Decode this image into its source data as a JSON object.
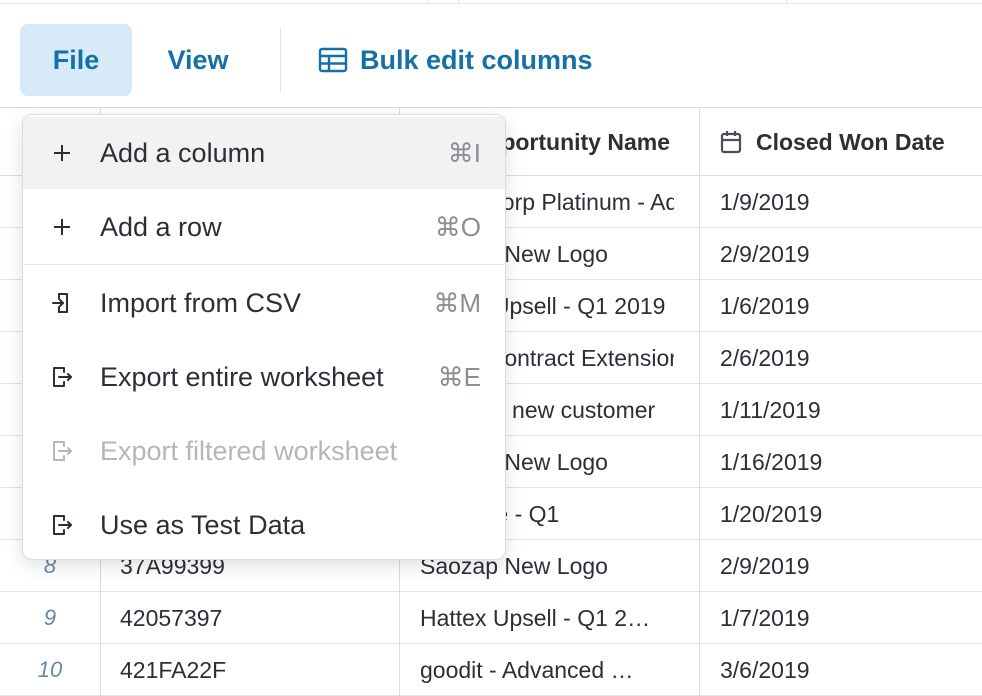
{
  "toolbar": {
    "file_label": "File",
    "view_label": "View",
    "bulk_edit_label": "Bulk edit columns",
    "accent_color": "#1570a6"
  },
  "grid": {
    "headers": {
      "opportunity_name": "Opportunity Name",
      "closed_won_date": "Closed Won Date"
    },
    "rows": [
      {
        "num": "",
        "id": "",
        "name": "Acme Corp Platinum - Advanced Package",
        "date": "1/9/2019"
      },
      {
        "num": "",
        "id": "",
        "name": "Saozap New Logo",
        "date": "2/9/2019"
      },
      {
        "num": "",
        "id": "",
        "name": "Hattex Upsell - Q1 2019",
        "date": "1/6/2019"
      },
      {
        "num": "",
        "id": "",
        "name": "Cirrus Contract Extension",
        "date": "2/6/2019"
      },
      {
        "num": "",
        "id": "",
        "name": "Runlex - new customer",
        "date": "1/11/2019"
      },
      {
        "num": "",
        "id": "",
        "name": "Holding New Logo",
        "date": "1/16/2019"
      },
      {
        "num": "",
        "id": "",
        "name": "Finelane - Q1",
        "date": "1/20/2019"
      },
      {
        "num": "8",
        "id": "37A99399",
        "name": "Saozap New Logo",
        "date": "2/9/2019"
      },
      {
        "num": "9",
        "id": "42057397",
        "name": "Hattex Upsell - Q1 2…",
        "date": "1/7/2019"
      },
      {
        "num": "10",
        "id": "421FA22F",
        "name": "goodit - Advanced …",
        "date": "3/6/2019"
      }
    ]
  },
  "menu": {
    "items": [
      {
        "label": "Add a column",
        "shortcut": "⌘I",
        "icon": "plus-icon"
      },
      {
        "label": "Add a row",
        "shortcut": "⌘O",
        "icon": "plus-icon"
      },
      {
        "label": "Import from CSV",
        "shortcut": "⌘M",
        "icon": "import-icon"
      },
      {
        "label": "Export entire worksheet",
        "shortcut": "⌘E",
        "icon": "export-icon"
      },
      {
        "label": "Export filtered worksheet",
        "shortcut": "",
        "icon": "export-icon"
      },
      {
        "label": "Use as Test Data",
        "shortcut": "",
        "icon": "export-icon"
      }
    ]
  }
}
